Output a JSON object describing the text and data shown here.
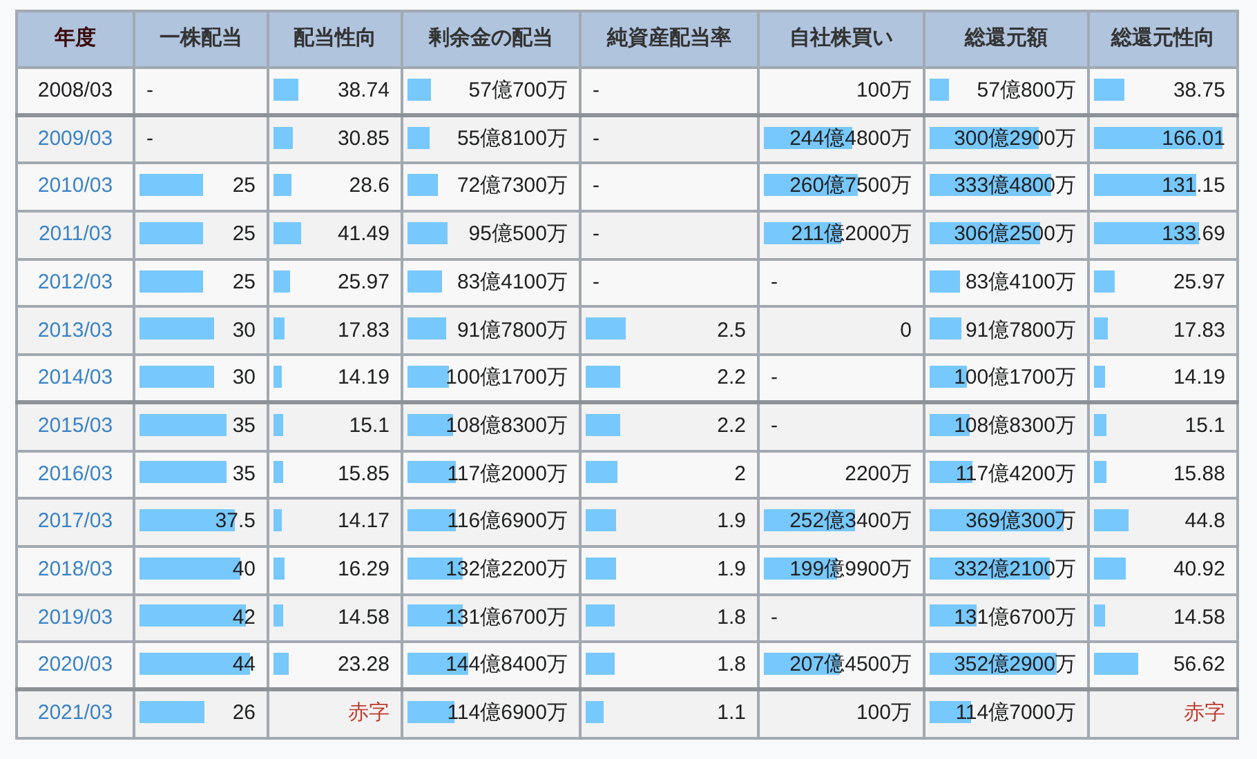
{
  "table": {
    "columns": [
      "年度",
      "一株配当",
      "配当性向",
      "剰余金の配当",
      "純資産配当率",
      "自社株買い",
      "総還元額",
      "総還元性向"
    ],
    "rows": [
      {
        "divider": false,
        "cells": [
          {
            "kind": "year",
            "text": "2008/03"
          },
          {
            "kind": "dash",
            "text": "-"
          },
          {
            "kind": "num",
            "text": "38.74",
            "level": 0.2
          },
          {
            "kind": "num",
            "text": "57億700万",
            "level": 0.14
          },
          {
            "kind": "dash",
            "text": "-"
          },
          {
            "kind": "num",
            "text": "100万"
          },
          {
            "kind": "num",
            "text": "57億800万",
            "level": 0.13
          },
          {
            "kind": "num",
            "text": "38.75",
            "level": 0.22
          }
        ]
      },
      {
        "divider": true,
        "cells": [
          {
            "kind": "link",
            "text": "2009/03"
          },
          {
            "kind": "dash",
            "text": "-"
          },
          {
            "kind": "num",
            "text": "30.85",
            "level": 0.16
          },
          {
            "kind": "num",
            "text": "55億8100万",
            "level": 0.13
          },
          {
            "kind": "dash",
            "text": "-"
          },
          {
            "kind": "num",
            "text": "244億4800万",
            "level": 0.57
          },
          {
            "kind": "num",
            "text": "300億2900万",
            "level": 0.71
          },
          {
            "kind": "num",
            "text": "166.01",
            "level": 0.93
          }
        ]
      },
      {
        "divider": false,
        "cells": [
          {
            "kind": "link",
            "text": "2010/03"
          },
          {
            "kind": "num",
            "text": "25",
            "level": 0.52
          },
          {
            "kind": "num",
            "text": "28.6",
            "level": 0.15
          },
          {
            "kind": "num",
            "text": "72億7300万",
            "level": 0.18
          },
          {
            "kind": "dash",
            "text": "-"
          },
          {
            "kind": "num",
            "text": "260億7500万",
            "level": 0.61
          },
          {
            "kind": "num",
            "text": "333億4800万",
            "level": 0.79
          },
          {
            "kind": "num",
            "text": "131.15",
            "level": 0.74
          }
        ]
      },
      {
        "divider": false,
        "cells": [
          {
            "kind": "link",
            "text": "2011/03"
          },
          {
            "kind": "num",
            "text": "25",
            "level": 0.52
          },
          {
            "kind": "num",
            "text": "41.49",
            "level": 0.22
          },
          {
            "kind": "num",
            "text": "95億500万",
            "level": 0.24
          },
          {
            "kind": "dash",
            "text": "-"
          },
          {
            "kind": "num",
            "text": "211億2000万",
            "level": 0.5
          },
          {
            "kind": "num",
            "text": "306億2500万",
            "level": 0.72
          },
          {
            "kind": "num",
            "text": "133.69",
            "level": 0.76
          }
        ]
      },
      {
        "divider": false,
        "cells": [
          {
            "kind": "link",
            "text": "2012/03"
          },
          {
            "kind": "num",
            "text": "25",
            "level": 0.52
          },
          {
            "kind": "num",
            "text": "25.97",
            "level": 0.14
          },
          {
            "kind": "num",
            "text": "83億4100万",
            "level": 0.21
          },
          {
            "kind": "dash",
            "text": "-"
          },
          {
            "kind": "dash",
            "text": "-"
          },
          {
            "kind": "num",
            "text": "83億4100万",
            "level": 0.2
          },
          {
            "kind": "num",
            "text": "25.97",
            "level": 0.15
          }
        ]
      },
      {
        "divider": false,
        "cells": [
          {
            "kind": "link",
            "text": "2013/03"
          },
          {
            "kind": "num",
            "text": "30",
            "level": 0.61
          },
          {
            "kind": "num",
            "text": "17.83",
            "level": 0.09
          },
          {
            "kind": "num",
            "text": "91億7800万",
            "level": 0.23
          },
          {
            "kind": "num",
            "text": "2.5",
            "level": 0.24
          },
          {
            "kind": "num",
            "text": "0"
          },
          {
            "kind": "num",
            "text": "91億7800万",
            "level": 0.21
          },
          {
            "kind": "num",
            "text": "17.83",
            "level": 0.1
          }
        ]
      },
      {
        "divider": false,
        "cells": [
          {
            "kind": "link",
            "text": "2014/03"
          },
          {
            "kind": "num",
            "text": "30",
            "level": 0.61
          },
          {
            "kind": "num",
            "text": "14.19",
            "level": 0.07
          },
          {
            "kind": "num",
            "text": "100億1700万",
            "level": 0.25
          },
          {
            "kind": "num",
            "text": "2.2",
            "level": 0.21
          },
          {
            "kind": "dash",
            "text": "-"
          },
          {
            "kind": "num",
            "text": "100億1700万",
            "level": 0.24
          },
          {
            "kind": "num",
            "text": "14.19",
            "level": 0.08
          }
        ]
      },
      {
        "divider": true,
        "cells": [
          {
            "kind": "link",
            "text": "2015/03"
          },
          {
            "kind": "num",
            "text": "35",
            "level": 0.71
          },
          {
            "kind": "num",
            "text": "15.1",
            "level": 0.08
          },
          {
            "kind": "num",
            "text": "108億8300万",
            "level": 0.27
          },
          {
            "kind": "num",
            "text": "2.2",
            "level": 0.21
          },
          {
            "kind": "dash",
            "text": "-"
          },
          {
            "kind": "num",
            "text": "108億8300万",
            "level": 0.26
          },
          {
            "kind": "num",
            "text": "15.1",
            "level": 0.09
          }
        ]
      },
      {
        "divider": false,
        "cells": [
          {
            "kind": "link",
            "text": "2016/03"
          },
          {
            "kind": "num",
            "text": "35",
            "level": 0.71
          },
          {
            "kind": "num",
            "text": "15.85",
            "level": 0.08
          },
          {
            "kind": "num",
            "text": "117億2000万",
            "level": 0.29
          },
          {
            "kind": "num",
            "text": "2",
            "level": 0.19
          },
          {
            "kind": "num",
            "text": "2200万"
          },
          {
            "kind": "num",
            "text": "117億4200万",
            "level": 0.28
          },
          {
            "kind": "num",
            "text": "15.88",
            "level": 0.09
          }
        ]
      },
      {
        "divider": false,
        "cells": [
          {
            "kind": "link",
            "text": "2017/03"
          },
          {
            "kind": "num",
            "text": "37.5",
            "level": 0.77
          },
          {
            "kind": "num",
            "text": "14.17",
            "level": 0.07
          },
          {
            "kind": "num",
            "text": "116億6900万",
            "level": 0.29
          },
          {
            "kind": "num",
            "text": "1.9",
            "level": 0.18
          },
          {
            "kind": "num",
            "text": "252億3400万",
            "level": 0.59
          },
          {
            "kind": "num",
            "text": "369億300万",
            "level": 0.87
          },
          {
            "kind": "num",
            "text": "44.8",
            "level": 0.25
          }
        ]
      },
      {
        "divider": false,
        "cells": [
          {
            "kind": "link",
            "text": "2018/03"
          },
          {
            "kind": "num",
            "text": "40",
            "level": 0.82
          },
          {
            "kind": "num",
            "text": "16.29",
            "level": 0.09
          },
          {
            "kind": "num",
            "text": "132億2200万",
            "level": 0.33
          },
          {
            "kind": "num",
            "text": "1.9",
            "level": 0.18
          },
          {
            "kind": "num",
            "text": "199億9900万",
            "level": 0.47
          },
          {
            "kind": "num",
            "text": "332億2100万",
            "level": 0.78
          },
          {
            "kind": "num",
            "text": "40.92",
            "level": 0.23
          }
        ]
      },
      {
        "divider": false,
        "cells": [
          {
            "kind": "link",
            "text": "2019/03"
          },
          {
            "kind": "num",
            "text": "42",
            "level": 0.86
          },
          {
            "kind": "num",
            "text": "14.58",
            "level": 0.08
          },
          {
            "kind": "num",
            "text": "131億6700万",
            "level": 0.33
          },
          {
            "kind": "num",
            "text": "1.8",
            "level": 0.17
          },
          {
            "kind": "dash",
            "text": "-"
          },
          {
            "kind": "num",
            "text": "131億6700万",
            "level": 0.31
          },
          {
            "kind": "num",
            "text": "14.58",
            "level": 0.08
          }
        ]
      },
      {
        "divider": false,
        "cells": [
          {
            "kind": "link",
            "text": "2020/03"
          },
          {
            "kind": "num",
            "text": "44",
            "level": 0.9
          },
          {
            "kind": "num",
            "text": "23.28",
            "level": 0.12
          },
          {
            "kind": "num",
            "text": "144億8400万",
            "level": 0.36
          },
          {
            "kind": "num",
            "text": "1.8",
            "level": 0.17
          },
          {
            "kind": "num",
            "text": "207億4500万",
            "level": 0.49
          },
          {
            "kind": "num",
            "text": "352億2900万",
            "level": 0.83
          },
          {
            "kind": "num",
            "text": "56.62",
            "level": 0.32
          }
        ]
      },
      {
        "divider": true,
        "cells": [
          {
            "kind": "link",
            "text": "2021/03"
          },
          {
            "kind": "num",
            "text": "26",
            "level": 0.53
          },
          {
            "kind": "deficit",
            "text": "赤字"
          },
          {
            "kind": "num",
            "text": "114億6900万",
            "level": 0.28
          },
          {
            "kind": "num",
            "text": "1.1",
            "level": 0.11
          },
          {
            "kind": "num",
            "text": "100万"
          },
          {
            "kind": "num",
            "text": "114億7000万",
            "level": 0.27
          },
          {
            "kind": "deficit",
            "text": "赤字"
          }
        ]
      }
    ]
  }
}
